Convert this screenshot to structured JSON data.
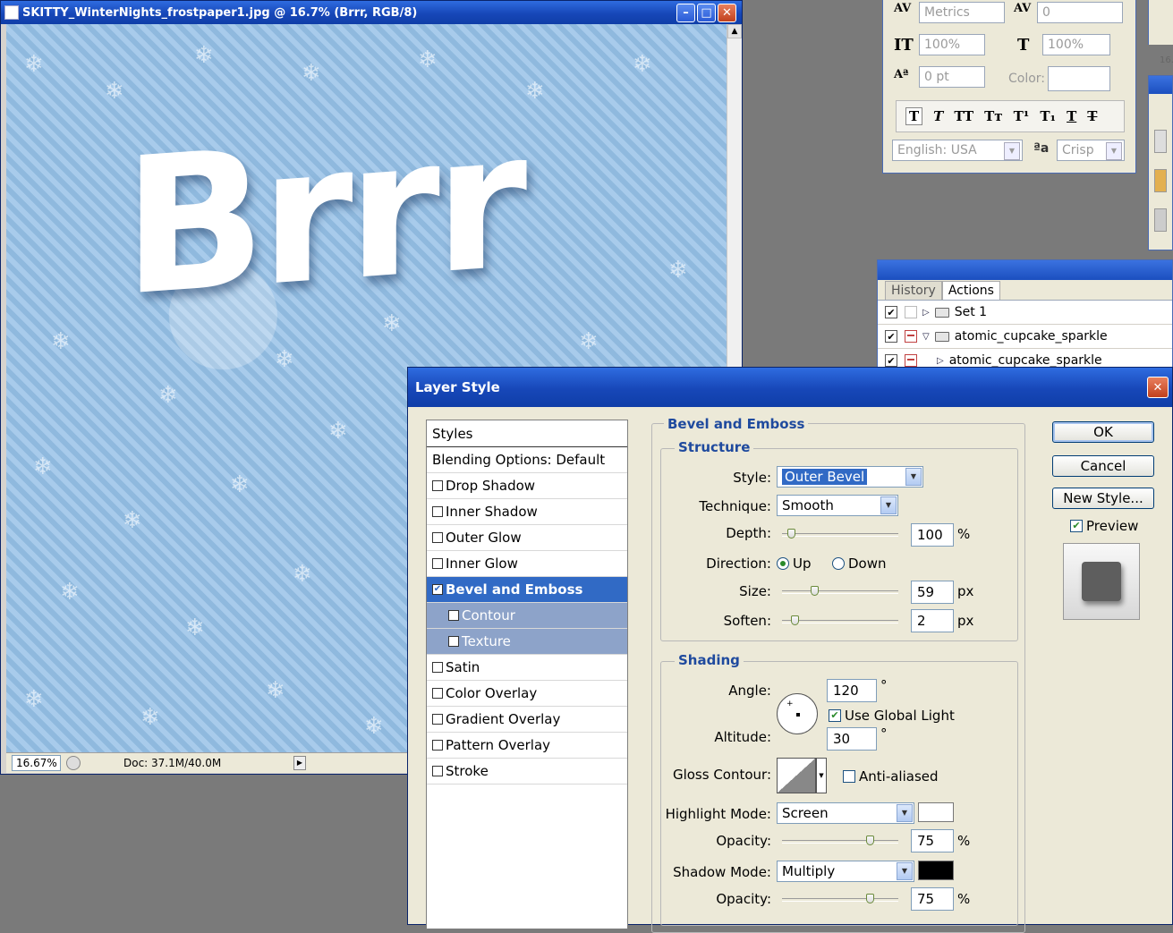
{
  "doc": {
    "title": "SKITTY_WinterNights_frostpaper1.jpg @ 16.7% (Brrr, RGB/8)",
    "canvas_text": "Brrr",
    "zoom": "16.67%",
    "doc_info": "Doc: 37.1M/40.0M"
  },
  "character": {
    "tracking": "Metrics",
    "tracking_value": "0",
    "vscale": "100%",
    "hscale": "100%",
    "baseline": "0 pt",
    "color_label": "Color:",
    "language": "English: USA",
    "antialias": "Crisp",
    "antialias_glyph": "ªa",
    "right_stub_label": "16."
  },
  "actions": {
    "tab_history": "History",
    "tab_actions": "Actions",
    "rows": [
      {
        "label": "Set 1"
      },
      {
        "label": "atomic_cupcake_sparkle"
      },
      {
        "label": "atomic_cupcake_sparkle"
      }
    ]
  },
  "dialog": {
    "title": "Layer Style",
    "styles_header": "Styles",
    "items": [
      {
        "label": "Blending Options: Default"
      },
      {
        "label": "Drop Shadow"
      },
      {
        "label": "Inner Shadow"
      },
      {
        "label": "Outer Glow"
      },
      {
        "label": "Inner Glow"
      },
      {
        "label": "Bevel and Emboss"
      },
      {
        "label": "Contour"
      },
      {
        "label": "Texture"
      },
      {
        "label": "Satin"
      },
      {
        "label": "Color Overlay"
      },
      {
        "label": "Gradient Overlay"
      },
      {
        "label": "Pattern Overlay"
      },
      {
        "label": "Stroke"
      }
    ],
    "section_title": "Bevel and Emboss",
    "structure": {
      "title": "Structure",
      "style_label": "Style:",
      "style_value": "Outer Bevel",
      "technique_label": "Technique:",
      "technique_value": "Smooth",
      "depth_label": "Depth:",
      "depth_value": "100",
      "depth_unit": "%",
      "direction_label": "Direction:",
      "dir_up": "Up",
      "dir_down": "Down",
      "size_label": "Size:",
      "size_value": "59",
      "size_unit": "px",
      "soften_label": "Soften:",
      "soften_value": "2",
      "soften_unit": "px"
    },
    "shading": {
      "title": "Shading",
      "angle_label": "Angle:",
      "angle_value": "120",
      "deg": "°",
      "global_light": "Use Global Light",
      "altitude_label": "Altitude:",
      "altitude_value": "30",
      "gloss_label": "Gloss Contour:",
      "anti_aliased": "Anti-aliased",
      "highlight_label": "Highlight Mode:",
      "highlight_value": "Screen",
      "highlight_color": "#ffffff",
      "opacity_label": "Opacity:",
      "highlight_opacity": "75",
      "shadow_label": "Shadow Mode:",
      "shadow_value": "Multiply",
      "shadow_color": "#000000",
      "shadow_opacity": "75",
      "pct": "%"
    },
    "buttons": {
      "ok": "OK",
      "cancel": "Cancel",
      "new_style": "New Style...",
      "preview": "Preview"
    }
  }
}
